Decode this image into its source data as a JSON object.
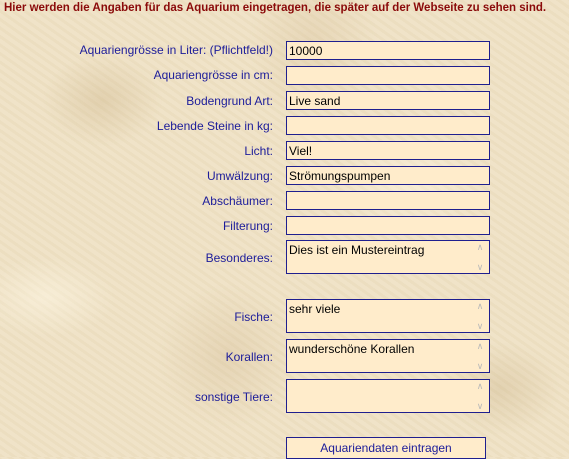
{
  "heading": "Hier werden die Angaben für das Aquarium eingetragen, die später auf der Webseite zu sehen sind.",
  "fields": [
    {
      "label": "Aquariengrösse in Liter: (Pflichtfeld!)",
      "value": "10000"
    },
    {
      "label": "Aquariengrösse in cm:",
      "value": ""
    },
    {
      "label": "Bodengrund Art:",
      "value": "Live sand"
    },
    {
      "label": "Lebende Steine in kg:",
      "value": ""
    },
    {
      "label": "Licht:",
      "value": "Viel!"
    },
    {
      "label": "Umwälzung:",
      "value": "Strömungspumpen"
    },
    {
      "label": "Abschäumer:",
      "value": ""
    },
    {
      "label": "Filterung:",
      "value": ""
    }
  ],
  "textareas": [
    {
      "label": "Besonderes:",
      "value": "Dies ist ein Mustereintrag"
    },
    {
      "label": "Fische:",
      "value": "sehr viele"
    },
    {
      "label": "Korallen:",
      "value": "wunderschöne Korallen"
    },
    {
      "label": "sonstige Tiere:",
      "value": ""
    }
  ],
  "submit_label": "Aquariendaten eintragen"
}
